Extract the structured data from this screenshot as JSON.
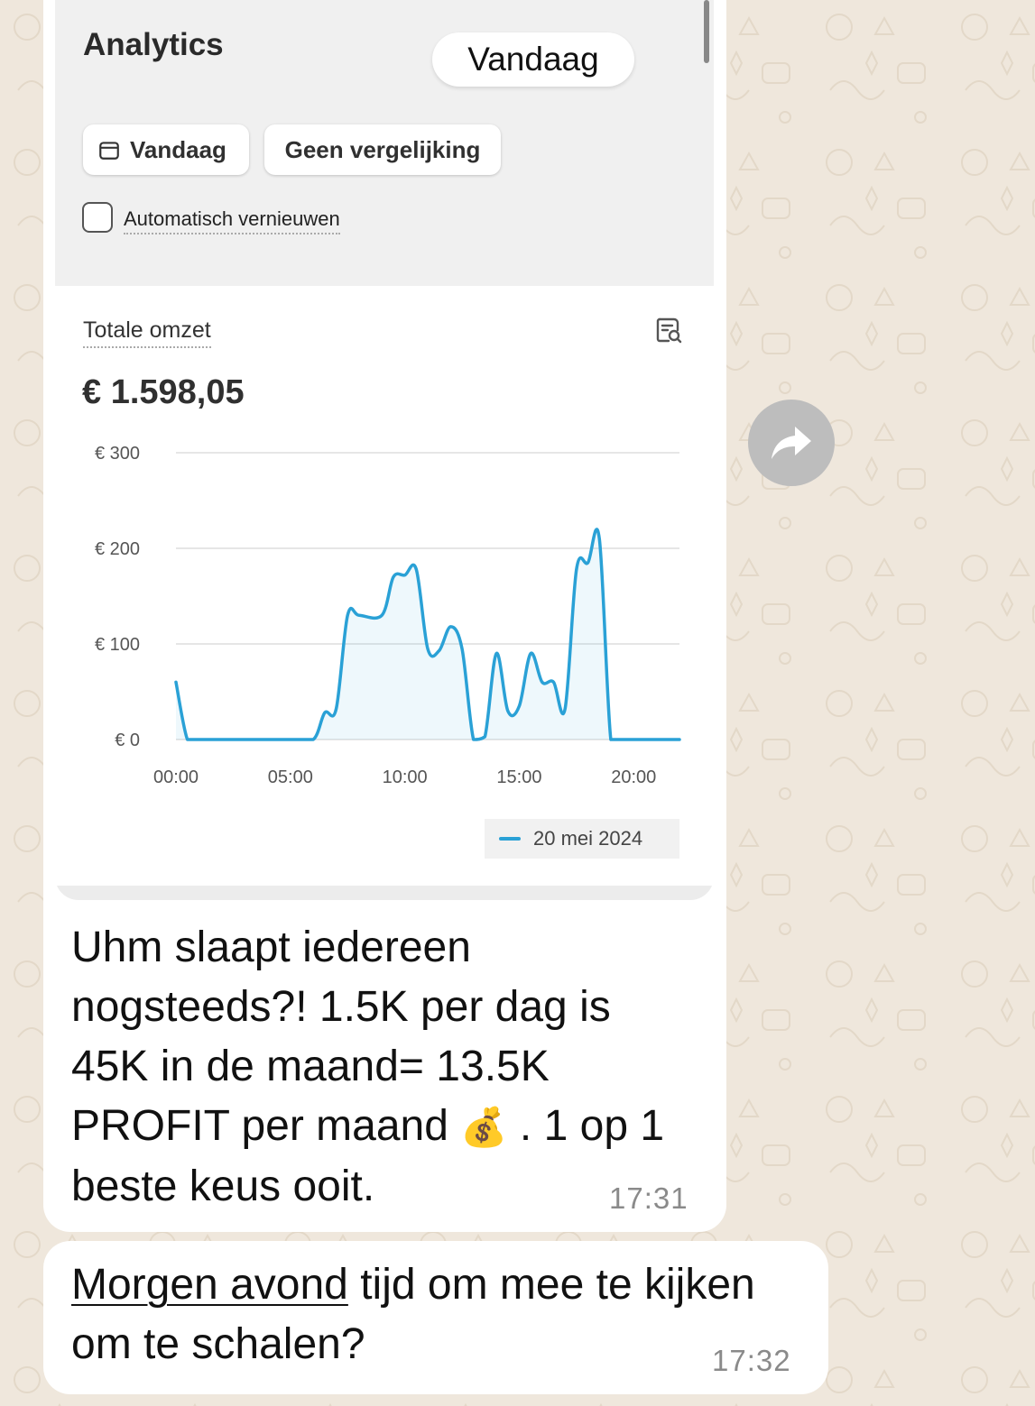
{
  "shot": {
    "title": "Analytics",
    "period_pill": "Vandaag",
    "date_button": "Vandaag",
    "compare_button": "Geen vergelijking",
    "auto_refresh_label": "Automatisch vernieuwen",
    "auto_refresh_checked": false,
    "metric_label": "Totale omzet",
    "metric_value": "€ 1.598,05",
    "legend_label": "20 mei 2024",
    "line_color": "#2aa1d6"
  },
  "chart_data": {
    "type": "area",
    "y_tick_labels": [
      "€ 300",
      "€ 200",
      "€ 100",
      "€ 0"
    ],
    "y_ticks": [
      300,
      200,
      100,
      0
    ],
    "x_tick_labels": [
      "00:00",
      "05:00",
      "10:00",
      "15:00",
      "20:00"
    ],
    "ylim": [
      0,
      300
    ],
    "xlim": [
      0,
      22
    ],
    "grid": true,
    "series": [
      {
        "name": "20 mei 2024",
        "x": [
          0,
          0.5,
          1,
          2,
          3,
          4,
          5,
          6,
          6.5,
          7,
          7.5,
          8,
          9,
          9.5,
          10,
          10.5,
          11,
          11.5,
          12,
          12.5,
          13,
          13.5,
          14,
          14.5,
          15,
          15.5,
          16,
          16.5,
          17,
          17.5,
          18,
          18.5,
          19,
          19.5,
          20,
          20.5,
          21,
          21.5,
          22
        ],
        "values": [
          60,
          0,
          0,
          0,
          0,
          0,
          0,
          0,
          28,
          32,
          130,
          130,
          130,
          170,
          172,
          178,
          95,
          93,
          118,
          95,
          0,
          3,
          90,
          30,
          35,
          90,
          60,
          60,
          32,
          178,
          185,
          210,
          0,
          0,
          0,
          0,
          0,
          0,
          0
        ]
      }
    ]
  },
  "messages": [
    {
      "text_before_emoji": "Uhm slaapt iedereen nogsteeds?! 1.5K per dag is 45K in de maand= 13.5K PROFIT per maand",
      "emoji": "💰",
      "text_after_emoji": ". 1 op 1 beste keus ooit.",
      "time": "17:31"
    },
    {
      "link_text": "Morgen avond",
      "text": " tijd om mee te kijken om te schalen?",
      "time": "17:32"
    }
  ]
}
